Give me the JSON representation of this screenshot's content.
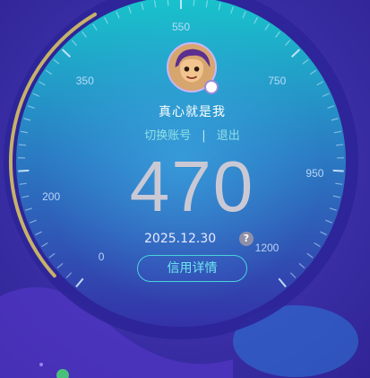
{
  "profile": {
    "username": "真心就是我",
    "switch_account_label": "切换账号",
    "separator": "|",
    "logout_label": "退出"
  },
  "credit": {
    "score": "470",
    "date": "2025.12.30",
    "help_symbol": "?",
    "detail_button_label": "信用详情",
    "gauge_min": 0,
    "gauge_max": 1200,
    "gauge_value": 470,
    "scale_labels": [
      "0",
      "200",
      "350",
      "550",
      "750",
      "950",
      "1200"
    ]
  },
  "colors": {
    "background": "#3a2aa6",
    "arc": "#c7b16a",
    "accent": "#4ad2db"
  },
  "icons": {
    "avatar": "cartoon-character-avatar",
    "badge": "verified-badge-icon",
    "help": "question-mark-icon"
  }
}
